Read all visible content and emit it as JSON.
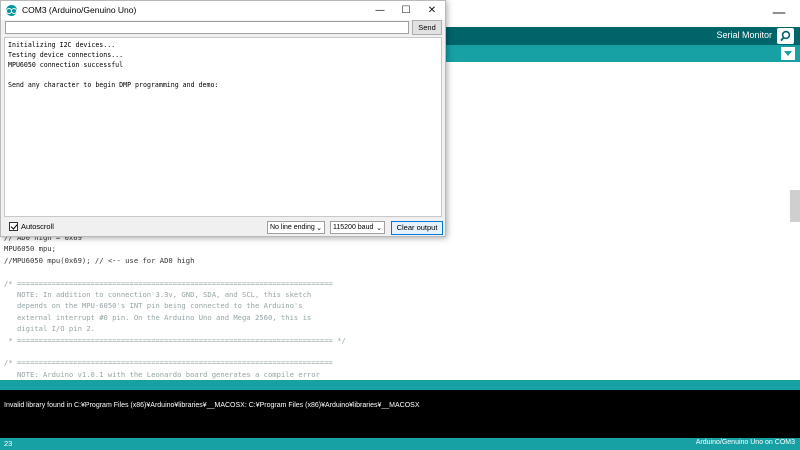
{
  "ide": {
    "serial_monitor_label": "Serial Monitor",
    "minimize_glyph": "—",
    "code_lines": [
      {
        "t": "// AD0 high = 0x69",
        "cls": ""
      },
      {
        "t": "MPU6050 mpu;",
        "cls": ""
      },
      {
        "t": "//MPU6050 mpu(0x69); // <-- use for AD0 high",
        "cls": ""
      },
      {
        "t": "",
        "cls": ""
      },
      {
        "t": "/* =========================================================================",
        "cls": "c"
      },
      {
        "t": "   NOTE: In addition to connection 3.3v, GND, SDA, and SCL, this sketch",
        "cls": "c"
      },
      {
        "t": "   depends on the MPU-6050's INT pin being connected to the Arduino's",
        "cls": "c"
      },
      {
        "t": "   external interrupt #0 pin. On the Arduino Uno and Mega 2560, this is",
        "cls": "c"
      },
      {
        "t": "   digital I/O pin 2.",
        "cls": "c"
      },
      {
        "t": " * ========================================================================= */",
        "cls": "c"
      },
      {
        "t": "",
        "cls": ""
      },
      {
        "t": "/* =========================================================================",
        "cls": "c"
      },
      {
        "t": "   NOTE: Arduino v1.0.1 with the Leonardo board generates a compile error",
        "cls": "c"
      },
      {
        "t": "   when using Serial.write(buf, len). The Teapot output uses this method.",
        "cls": "c"
      }
    ],
    "console_message": "Invalid library found in C:¥Program Files (x86)¥Arduino¥libraries¥__MACOSX: C:¥Program Files (x86)¥Arduino¥libraries¥__MACOSX",
    "status_line": "23",
    "status_board": "Arduino/Genuino Uno on COM3",
    "colors": {
      "toolbar": "#006468",
      "tabbar": "#17a1a5",
      "console_bg": "#000000"
    }
  },
  "serial_monitor": {
    "title": "COM3 (Arduino/Genuino Uno)",
    "window_buttons": {
      "minimize": "—",
      "maximize": "☐",
      "close": "✕"
    },
    "input_value": "",
    "send_label": "Send",
    "output_lines": [
      "Initializing I2C devices...",
      "Testing device connections...",
      "MPU6050 connection successful",
      "",
      "Send any character to begin DMP programming and demo:"
    ],
    "autoscroll_label": "Autoscroll",
    "autoscroll_checked": true,
    "line_ending": "No line ending",
    "baud_rate": "115200 baud",
    "clear_label": "Clear output"
  }
}
